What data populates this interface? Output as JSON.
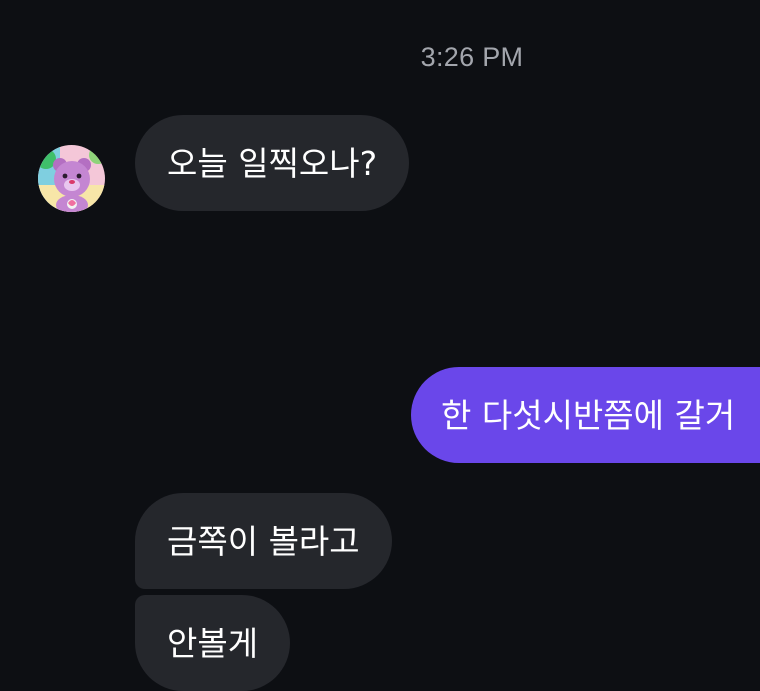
{
  "timestamp": "3:26 PM",
  "contact": {
    "avatar_icon": "care-bear-avatar"
  },
  "messages": [
    {
      "direction": "incoming",
      "text": "오늘 일찍오나?"
    },
    {
      "direction": "outgoing",
      "text": "한 다섯시반쯤에 갈거"
    },
    {
      "direction": "incoming",
      "text": "금쪽이 볼라고"
    },
    {
      "direction": "incoming",
      "text": "안볼게"
    }
  ],
  "colors": {
    "background": "#0d0f13",
    "incoming_bubble": "#25272c",
    "outgoing_bubble": "#6a47ea",
    "timestamp_text": "#a3a6ad"
  }
}
